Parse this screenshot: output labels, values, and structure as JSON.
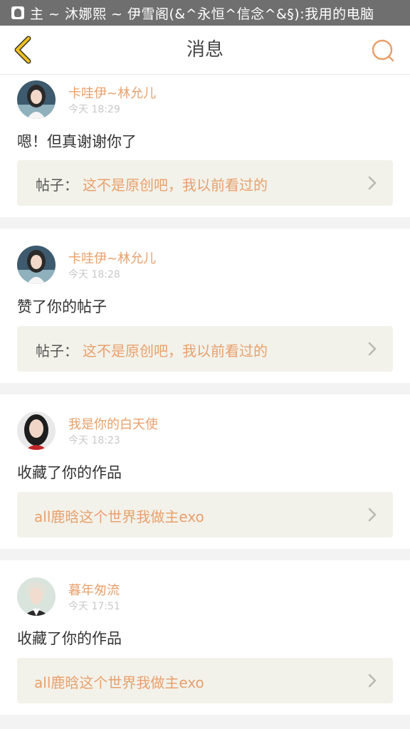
{
  "status_bar": {
    "text": "主 ~ 沐娜熙 ~ 伊雪阁(&^永恒^信念^&§):我用的电脑"
  },
  "header": {
    "title": "消息"
  },
  "icons": {
    "back": "back-chevron-icon",
    "search": "search-icon",
    "chevron": "chevron-right-icon",
    "status": "qq-notification-icon"
  },
  "colors": {
    "accent": "#e8a06c",
    "back_icon": "#f0c020",
    "post_box_bg": "#f2f2ea",
    "time": "#c8c8c8"
  },
  "notifications": [
    {
      "username": "卡哇伊~林允儿",
      "time": "今天  18:29",
      "message": "嗯！但真谢谢你了",
      "post_label": "帖子：",
      "post_title": "这不是原创吧，我以前看过的"
    },
    {
      "username": "卡哇伊~林允儿",
      "time": "今天  18:28",
      "message": "赞了你的帖子",
      "post_label": "帖子：",
      "post_title": "这不是原创吧，我以前看过的"
    },
    {
      "username": "我是你的白天使",
      "time": "今天  18:23",
      "message": "收藏了你的作品",
      "post_label": "",
      "post_title": "all鹿晗这个世界我做主exo"
    },
    {
      "username": "暮年匆流",
      "time": "今天  17:51",
      "message": "收藏了你的作品",
      "post_label": "",
      "post_title": "all鹿晗这个世界我做主exo"
    }
  ]
}
